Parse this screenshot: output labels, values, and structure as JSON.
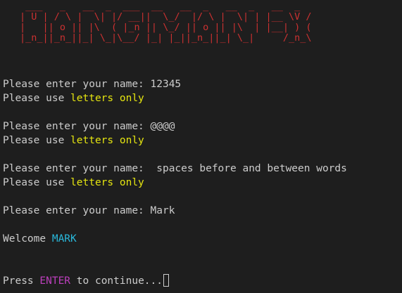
{
  "banner": {
    "lines": [
      " ___   _   __  _  ___  __   __  _   __  _   __  _ ",
      "| U | / \\ |  \\| |/ __||  \\_/  |/ \\ |  \\| | |__ \\V /",
      "|   || o || |\\  ( |_n || \\_/ || o || |\\  | |__| ) ( ",
      "|_n_||_n_||_| \\_|\\__/ |_| |_||_n_||_| \\_|     /_n_\\"
    ],
    "color": "#cd3131"
  },
  "session": {
    "attempt1": {
      "prompt": "Please enter your name: ",
      "input": "12345"
    },
    "error1": {
      "prefix": "Please use ",
      "highlight": "letters only"
    },
    "attempt2": {
      "prompt": "Please enter your name: ",
      "input": "@@@@"
    },
    "error2": {
      "prefix": "Please use ",
      "highlight": "letters only"
    },
    "attempt3": {
      "prompt": "Please enter your name: ",
      "input": " spaces before and between words"
    },
    "error3": {
      "prefix": "Please use ",
      "highlight": "letters only"
    },
    "attempt4": {
      "prompt": "Please enter your name: ",
      "input": "Mark"
    },
    "welcome": {
      "prefix": "Welcome ",
      "name": "MARK"
    },
    "continue": {
      "prefix": "Press ",
      "key": "ENTER",
      "suffix": " to continue..."
    }
  },
  "colors": {
    "background": "#1e1e1e",
    "text": "#cccccc",
    "highlight_yellow": "#e5e510",
    "highlight_blue": "#29b8db",
    "highlight_magenta": "#bc3fbc"
  }
}
